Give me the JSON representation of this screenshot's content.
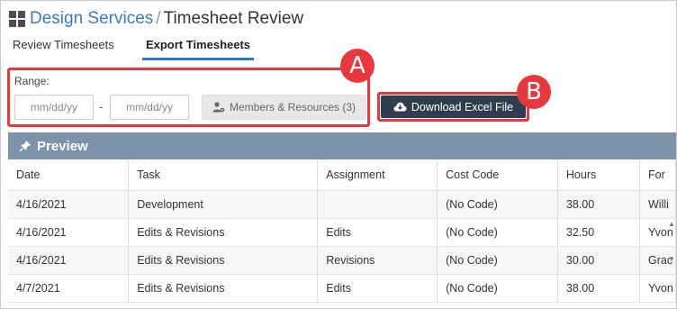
{
  "breadcrumb": {
    "parent": "Design Services",
    "separator": "/",
    "title": "Timesheet Review"
  },
  "tabs": [
    {
      "label": "Review Timesheets",
      "active": false
    },
    {
      "label": "Export Timesheets",
      "active": true
    }
  ],
  "range": {
    "label": "Range:",
    "from_placeholder": "mm/dd/yy",
    "to_placeholder": "mm/dd/yy",
    "dash": "-",
    "members_button": "Members & Resources (3)"
  },
  "download_button": "Download Excel File",
  "callouts": {
    "a": "A",
    "b": "B"
  },
  "preview": {
    "title": "Preview",
    "columns": [
      "Date",
      "Task",
      "Assignment",
      "Cost Code",
      "Hours",
      "For"
    ],
    "rows": [
      [
        "4/16/2021",
        "Development",
        "",
        "(No Code)",
        "38.00",
        "Willi"
      ],
      [
        "4/16/2021",
        "Edits & Revisions",
        "Edits",
        "(No Code)",
        "32.50",
        "Yvon"
      ],
      [
        "4/16/2021",
        "Edits & Revisions",
        "Revisions",
        "(No Code)",
        "30.00",
        "Grac"
      ],
      [
        "4/7/2021",
        "Edits & Revisions",
        "Edits",
        "(No Code)",
        "38.00",
        "Yvon"
      ]
    ]
  },
  "colors": {
    "accent": "#2e78c7",
    "callout": "#e8383d",
    "download_bg": "#2f3e4e",
    "preview_bar": "#7d93a9"
  },
  "icons": {
    "app": "grid-icon",
    "members": "user-gear-icon",
    "download": "cloud-download-icon",
    "preview": "pin-icon"
  }
}
